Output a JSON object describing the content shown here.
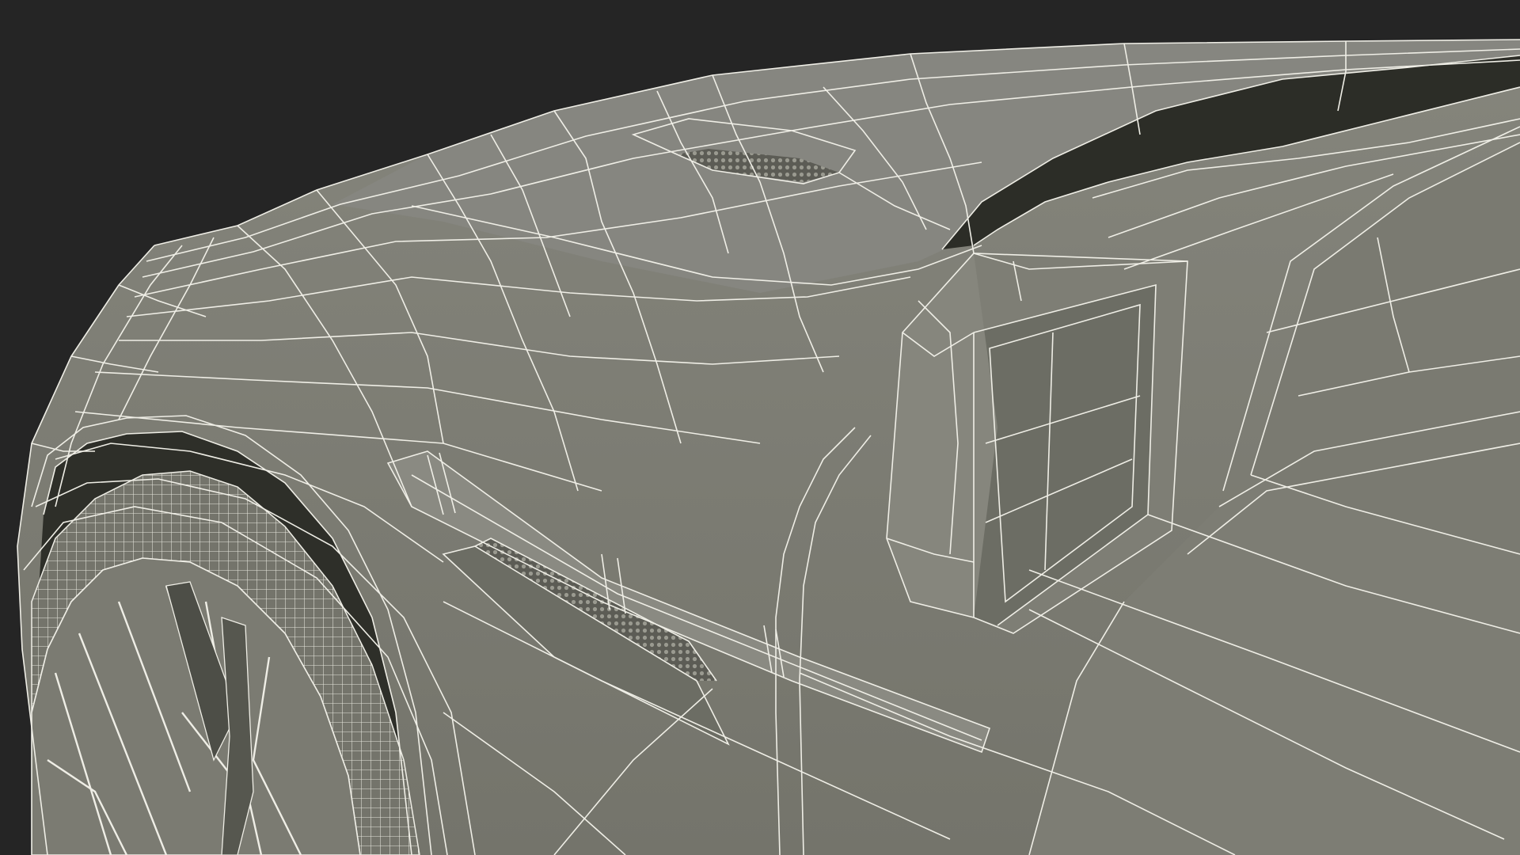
{
  "scene": {
    "subject": "wireframe-car-front-fender",
    "palette": {
      "background": "#252525",
      "body_fill": "#7a7a70",
      "body_fill_light": "#83837a",
      "body_fill_dark": "#65655d",
      "cavity": "#2c2d27",
      "wireframe": "#efeee6"
    }
  }
}
